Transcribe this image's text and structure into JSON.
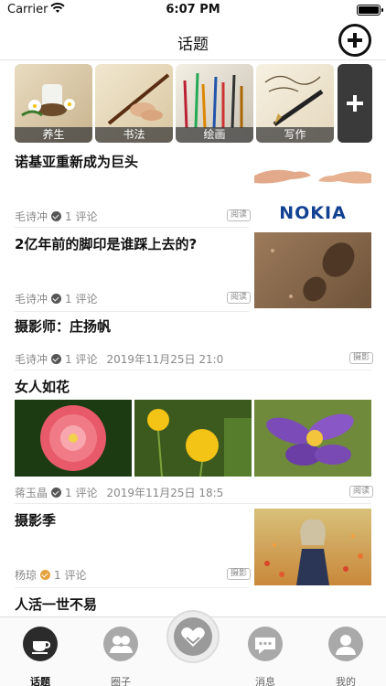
{
  "status_bar": {
    "carrier": "Carrier",
    "time": "6:07 PM"
  },
  "nav": {
    "title": "话题"
  },
  "categories": [
    {
      "label": "养生"
    },
    {
      "label": "书法"
    },
    {
      "label": "绘画"
    },
    {
      "label": "写作"
    }
  ],
  "feed": [
    {
      "title": "诺基亚重新成为巨头",
      "author": "毛诗冲",
      "comments": "1 评论",
      "tag": "阅读",
      "logo_text": "NOKIA"
    },
    {
      "title": "2亿年前的脚印是谁踩上去的?",
      "author": "毛诗冲",
      "comments": "1 评论",
      "tag": "阅读"
    },
    {
      "title": "摄影师：庄扬帆",
      "author": "毛诗冲",
      "comments": "1 评论",
      "date": "2019年11月25日 21:0",
      "tag": "摄影"
    },
    {
      "title": "女人如花",
      "author": "蒋玉晶",
      "comments": "1 评论",
      "date": "2019年11月25日 18:5",
      "tag": "阅读"
    },
    {
      "title": "摄影季",
      "author": "杨琼",
      "comments": "1 评论",
      "tag": "摄影"
    },
    {
      "title": "人活一世不易"
    }
  ],
  "tabbar": {
    "items": [
      {
        "label": "话题",
        "icon": "coffee-icon"
      },
      {
        "label": "圈子",
        "icon": "group-icon"
      },
      {
        "label": "",
        "icon": "heart-hands-icon"
      },
      {
        "label": "消息",
        "icon": "chat-icon"
      },
      {
        "label": "我的",
        "icon": "user-icon"
      }
    ]
  },
  "colors": {
    "nokia_blue": "#124191",
    "accent": "#2b2b2b",
    "verify_gold": "#e6a23c"
  }
}
